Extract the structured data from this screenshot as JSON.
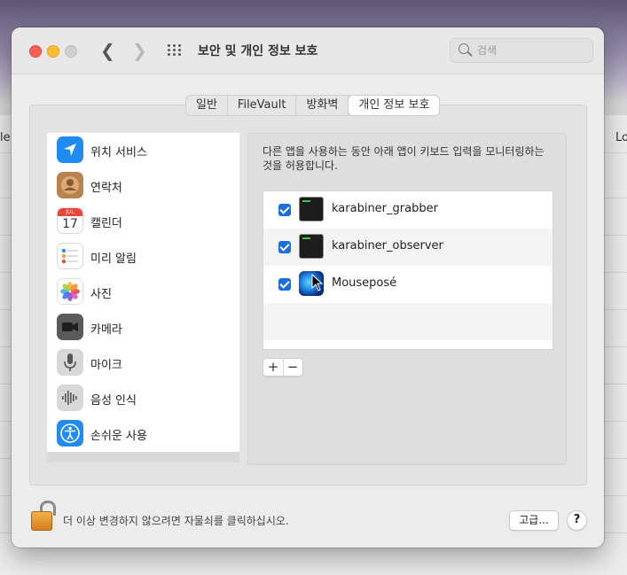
{
  "background": {
    "left_label": "le",
    "right_label": "Lo"
  },
  "window": {
    "title": "보안 및 개인 정보 보호",
    "search_placeholder": "검색",
    "tabs": [
      {
        "label": "일반",
        "active": false
      },
      {
        "label": "FileVault",
        "active": false
      },
      {
        "label": "방화벽",
        "active": false
      },
      {
        "label": "개인 정보 보호",
        "active": true
      }
    ],
    "sidebar": {
      "items": [
        {
          "label": "위치 서비스",
          "icon": "location-arrow-icon",
          "color": "#1f8bf3"
        },
        {
          "label": "연락처",
          "icon": "contacts-icon",
          "color": "#b8834f"
        },
        {
          "label": "캘린더",
          "icon": "calendar-icon",
          "month": "JUL",
          "day": "17"
        },
        {
          "label": "미리 알림",
          "icon": "reminders-icon"
        },
        {
          "label": "사진",
          "icon": "photos-icon"
        },
        {
          "label": "카메라",
          "icon": "camera-icon",
          "color": "#5a5a5a"
        },
        {
          "label": "마이크",
          "icon": "microphone-icon",
          "color": "#6e6e6e"
        },
        {
          "label": "음성 인식",
          "icon": "speech-recognition-icon",
          "color": "#7a7a7a"
        },
        {
          "label": "손쉬운 사용",
          "icon": "accessibility-icon",
          "color": "#1f8bf3"
        }
      ]
    },
    "detail": {
      "description": "다른 앱을 사용하는 동안 아래 앱이 키보드 입력을 모니터링하는 것을 허용합니다.",
      "apps": [
        {
          "name": "karabiner_grabber",
          "checked": true,
          "icon": "terminal-icon"
        },
        {
          "name": "karabiner_observer",
          "checked": true,
          "icon": "terminal-icon"
        },
        {
          "name": "Mouseposé",
          "checked": true,
          "icon": "mousepose-icon"
        }
      ],
      "add_label": "+",
      "remove_label": "−"
    },
    "footer": {
      "lock_text": "더 이상 변경하지 않으려면 자물쇠를 클릭하십시오.",
      "advanced_label": "고급...",
      "help_label": "?"
    }
  }
}
